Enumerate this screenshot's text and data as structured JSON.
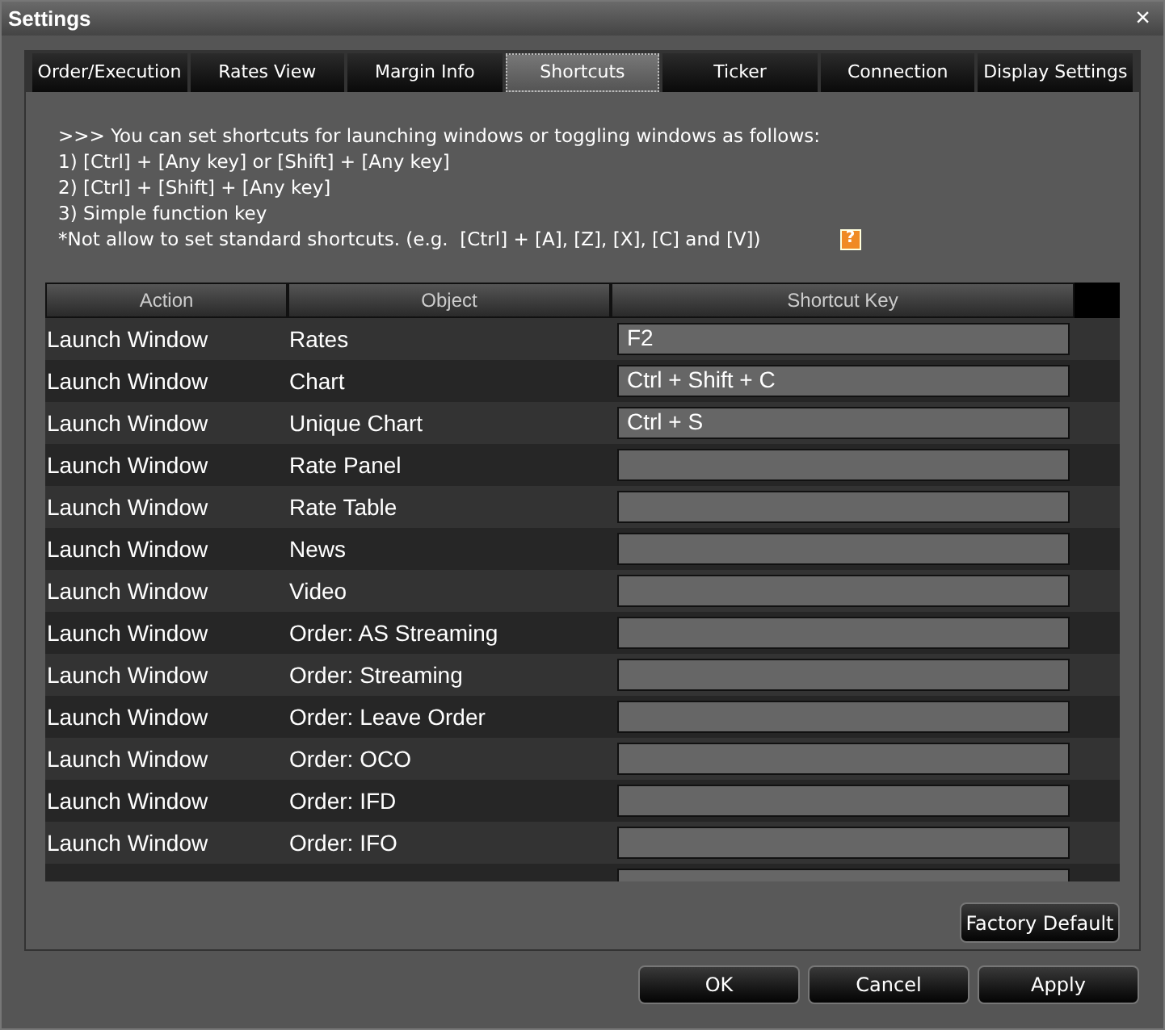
{
  "window": {
    "title": "Settings",
    "close": "×"
  },
  "tabs": [
    {
      "label": "Order/Execution",
      "selected": false
    },
    {
      "label": "Rates View",
      "selected": false
    },
    {
      "label": "Margin Info",
      "selected": false
    },
    {
      "label": "Shortcuts",
      "selected": true
    },
    {
      "label": "Ticker",
      "selected": false
    },
    {
      "label": "Connection",
      "selected": false
    },
    {
      "label": "Display Settings",
      "selected": false
    }
  ],
  "instructions": [
    ">>> You can set shortcuts for launching windows or toggling windows as follows:",
    "1) [Ctrl] + [Any key] or [Shift] + [Any key]",
    "2) [Ctrl] + [Shift] + [Any key]",
    "3) Simple function key",
    "*Not allow to set standard shortcuts. (e.g.  [Ctrl] + [A], [Z], [X], [C] and [V])"
  ],
  "help": "?",
  "table": {
    "columns": [
      "Action",
      "Object",
      "Shortcut Key"
    ],
    "rows": [
      {
        "action": "Launch Window",
        "object": "Rates",
        "key": "F2"
      },
      {
        "action": "Launch Window",
        "object": "Chart",
        "key": "Ctrl + Shift + C"
      },
      {
        "action": "Launch Window",
        "object": "Unique Chart",
        "key": "Ctrl + S"
      },
      {
        "action": "Launch Window",
        "object": "Rate Panel"
      },
      {
        "action": "Launch Window",
        "object": "Rate Table"
      },
      {
        "action": "Launch Window",
        "object": "News"
      },
      {
        "action": "Launch Window",
        "object": "Video"
      },
      {
        "action": "Launch Window",
        "object": "Order: AS Streaming"
      },
      {
        "action": "Launch Window",
        "object": "Order: Streaming"
      },
      {
        "action": "Launch Window",
        "object": "Order: Leave Order"
      },
      {
        "action": "Launch Window",
        "object": "Order: OCO"
      },
      {
        "action": "Launch Window",
        "object": "Order: IFD"
      },
      {
        "action": "Launch Window",
        "object": "Order: IFO"
      },
      {}
    ]
  },
  "factory_default": "Factory Default",
  "buttons": [
    "OK",
    "Cancel",
    "Apply"
  ]
}
